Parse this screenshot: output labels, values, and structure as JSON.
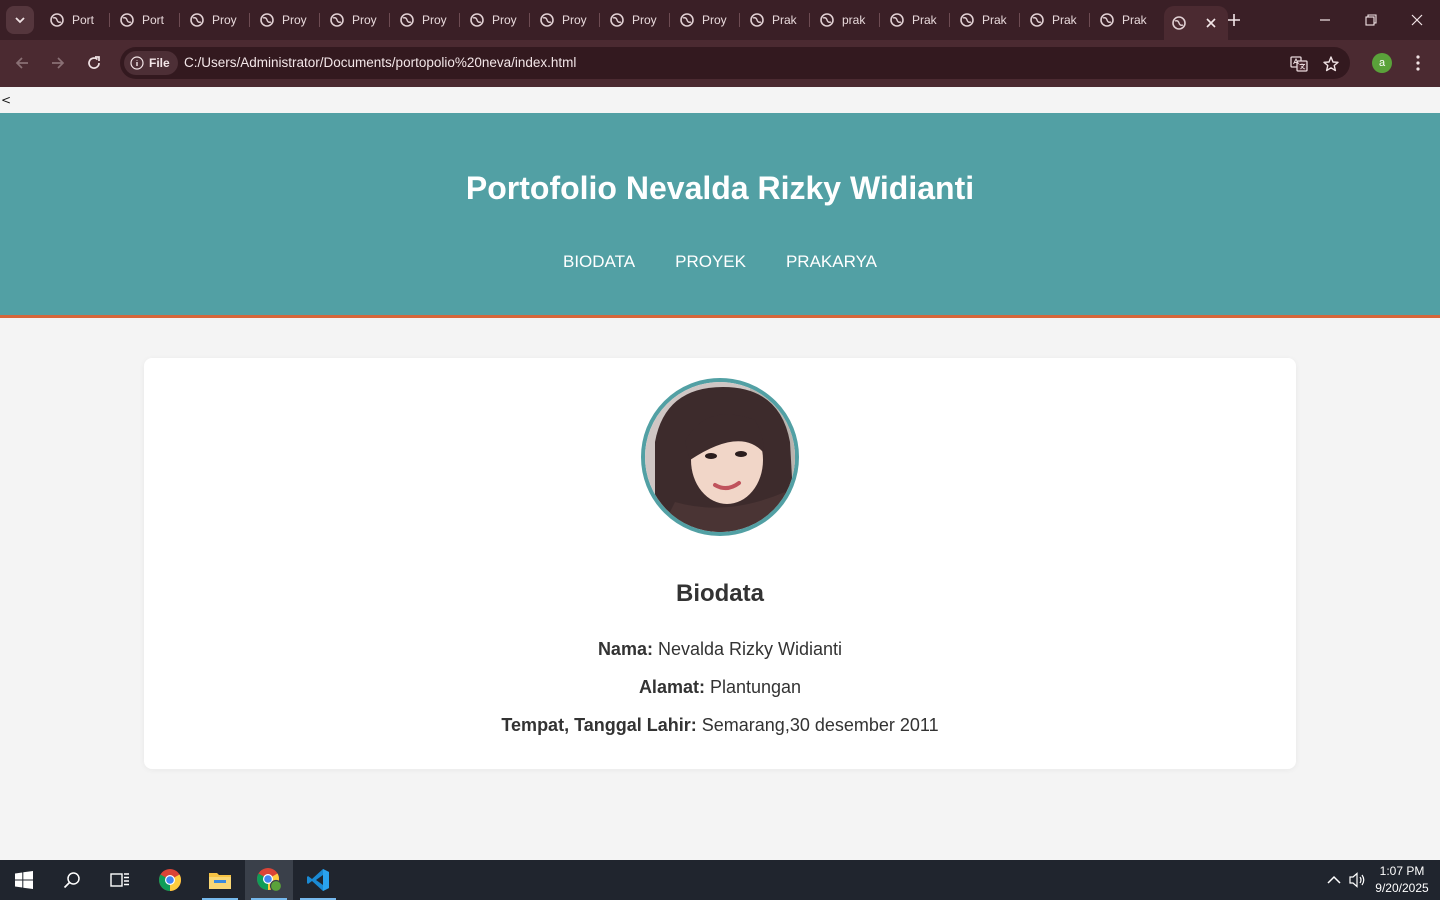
{
  "browser": {
    "tabs": [
      {
        "label": "Port"
      },
      {
        "label": "Port"
      },
      {
        "label": "Proy"
      },
      {
        "label": "Proy"
      },
      {
        "label": "Proy"
      },
      {
        "label": "Proy"
      },
      {
        "label": "Proy"
      },
      {
        "label": "Proy"
      },
      {
        "label": "Proy"
      },
      {
        "label": "Proy"
      },
      {
        "label": "Prak"
      },
      {
        "label": "prak"
      },
      {
        "label": "Prak"
      },
      {
        "label": "Prak"
      },
      {
        "label": "Prak"
      },
      {
        "label": "Prak"
      }
    ],
    "active_tab": {
      "label": ""
    },
    "address": {
      "scheme_chip": "File",
      "url": "C:/Users/Administrator/Documents/portopolio%20neva/index.html"
    },
    "profile_initial": "a"
  },
  "page": {
    "stray_text": "<",
    "header": {
      "title": "Portofolio Nevalda Rizky Widianti",
      "nav": [
        "BIODATA",
        "PROYEK",
        "PRAKARYA"
      ]
    },
    "biodata": {
      "heading": "Biodata",
      "fields": [
        {
          "label": "Nama:",
          "value": "Nevalda Rizky Widianti"
        },
        {
          "label": "Alamat:",
          "value": "Plantungan"
        },
        {
          "label": "Tempat, Tanggal Lahir:",
          "value": "Semarang,30 desember 2011"
        }
      ]
    }
  },
  "taskbar": {
    "apps": [
      "start-icon",
      "search-icon",
      "task-view-icon",
      "chrome-icon",
      "file-explorer-icon",
      "chrome-profile-icon",
      "vscode-icon"
    ],
    "clock": {
      "time": "1:07 PM",
      "date": "9/20/2025"
    }
  },
  "colors": {
    "header": "#52a0a4",
    "header_border": "#d6663a",
    "tabstrip": "#3a1f26",
    "toolbar": "#4b2a31",
    "taskbar": "#20252e"
  }
}
